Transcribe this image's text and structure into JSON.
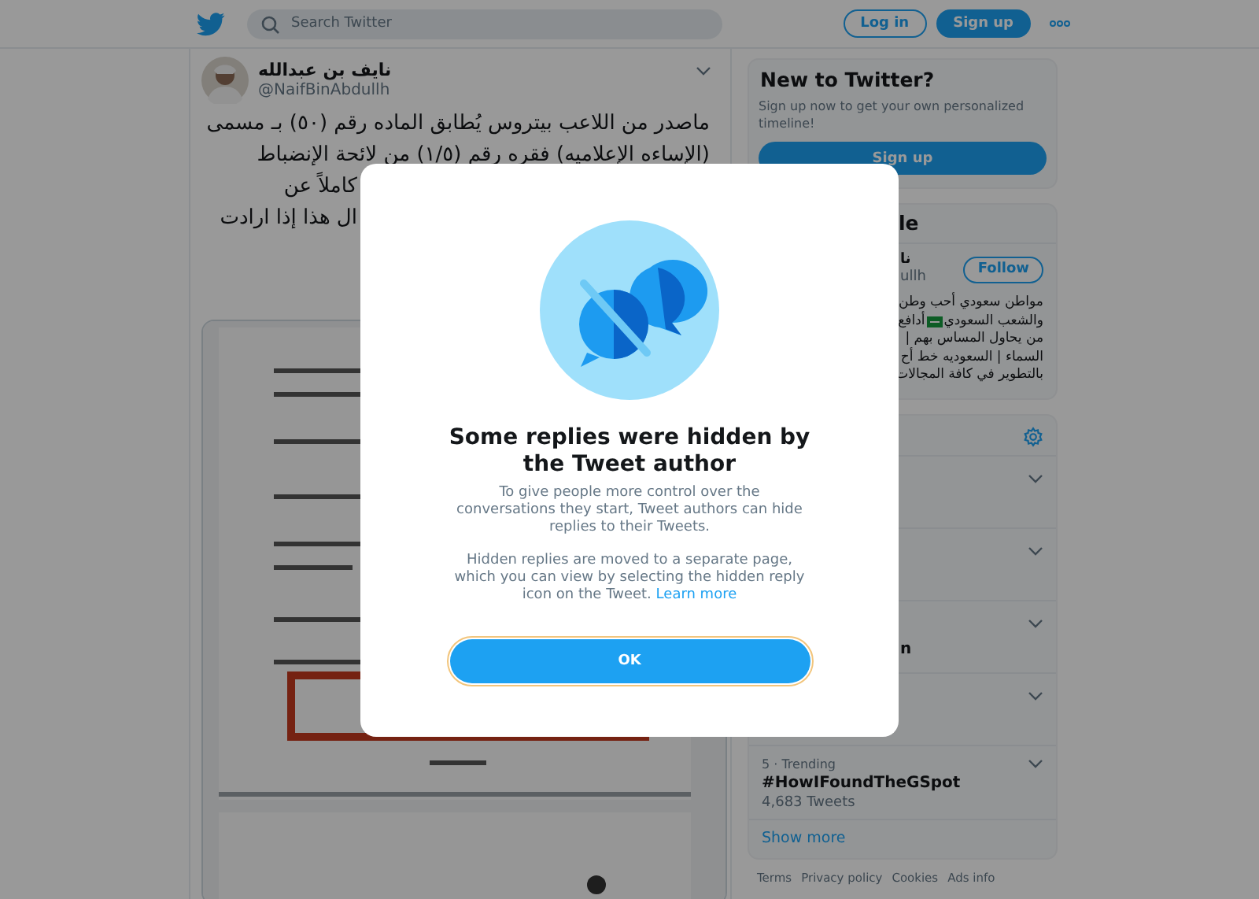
{
  "header": {
    "search": {
      "placeholder": "Search Twitter"
    },
    "buttons": [
      {
        "label": "Log in",
        "kind": "outline"
      },
      {
        "label": "Sign up",
        "kind": "filled"
      }
    ]
  },
  "tweet": {
    "author": {
      "name": "نايف بن عبدالله",
      "handle": "@NaifBinAbdullh"
    },
    "lines": [
      {
        "text": "ماصدر من اللاعب بيتروس يُطابق الماده رقم (٥٠) بـ مسمى",
        "kind": "full"
      },
      {
        "text": "(الإساءه الإعلاميه) فقره رقم (١/٥) من لائحة الإنضباط",
        "kind": "full"
      },
      {
        "text": "كاملاً عن",
        "kind": "covered"
      },
      {
        "text": "ال هذا إذا ارادت",
        "kind": "covered"
      }
    ]
  },
  "sidebar": {
    "signup_panel": {
      "title": "New to Twitter?",
      "text": "Sign up now to get your own personalized timeline!",
      "button": "Sign up"
    },
    "people_panel": {
      "title": "le",
      "person": {
        "name": "نا",
        "handle": "ullh",
        "button": "Follow",
        "bio_lines": [
          {
            "segments": [
              {
                "kind": "text",
                "text": "مواطن سعودي أحب وطن"
              }
            ]
          },
          {
            "segments": [
              {
                "kind": "text",
                "text": "والشعب السعودي"
              },
              {
                "kind": "flag"
              },
              {
                "kind": "text",
                "text": "أدافع"
              }
            ]
          },
          {
            "segments": [
              {
                "kind": "text",
                "text": "من يحاول المساس بهم |"
              }
            ]
          },
          {
            "segments": [
              {
                "kind": "text",
                "text": "السماء | السعوديه خط أح"
              }
            ]
          },
          {
            "segments": [
              {
                "kind": "text",
                "text": "بالتطوير في كافة المجالات"
              }
            ]
          }
        ]
      }
    },
    "trends_panel": {
      "trends": [
        {
          "kind": "covered"
        },
        {
          "kind": "covered"
        },
        {
          "kind": "covered",
          "name": "n"
        },
        {
          "kind": "covered"
        },
        {
          "kind": "shown",
          "meta": "5 · Trending",
          "name": "#HowIFoundTheGSpot",
          "count": "4,683 Tweets"
        }
      ],
      "show_more": "Show more"
    },
    "footer_links": [
      "Terms",
      "Privacy policy",
      "Cookies",
      "Ads info"
    ]
  },
  "dialog": {
    "title": "Some replies were hidden by the Tweet author",
    "paragraphs": [
      "To give people more control over the conversations they start, Tweet authors can hide replies to their Tweets.",
      "Hidden replies are moved to a separate page, which you can view by selecting the hidden reply icon on the Tweet."
    ],
    "link": "Learn more",
    "button": "OK"
  }
}
